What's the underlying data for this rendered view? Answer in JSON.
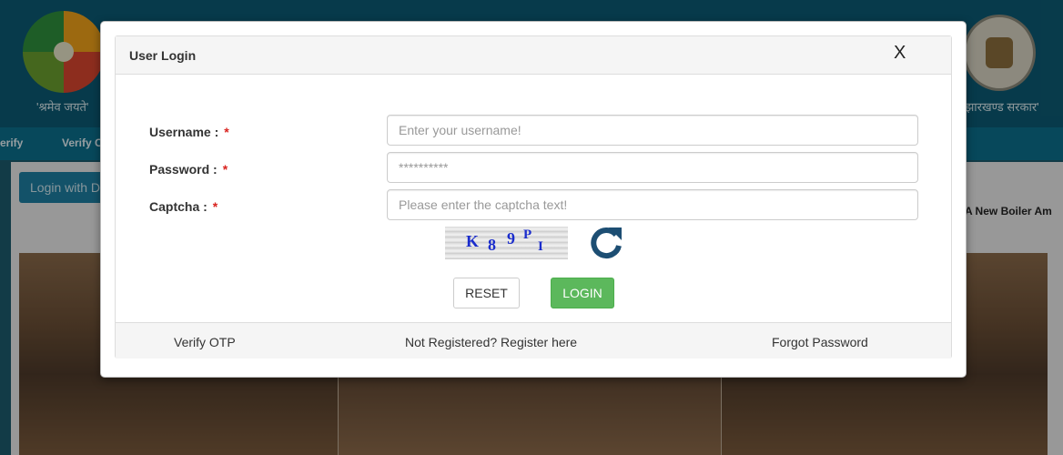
{
  "background": {
    "left_logo_caption": "'श्रमेव जयते'",
    "right_logo_caption": "'झारखण्ड सरकार'",
    "nav_items": [
      "erify",
      "Verify C"
    ],
    "side_button_label": "Login with D",
    "marquee_text": "A New Boiler Am"
  },
  "modal": {
    "title": "User Login",
    "close_label": "X",
    "fields": {
      "username": {
        "label": "Username :",
        "required_mark": "*",
        "placeholder": "Enter your username!",
        "value": ""
      },
      "password": {
        "label": "Password :",
        "required_mark": "*",
        "placeholder": "**********",
        "value": ""
      },
      "captcha": {
        "label": "Captcha :",
        "required_mark": "*",
        "placeholder": "Please enter the captcha text!",
        "value": ""
      }
    },
    "captcha_text": [
      "K",
      "8",
      "9",
      "P",
      "I"
    ],
    "buttons": {
      "reset": "RESET",
      "login": "LOGIN"
    },
    "footer": {
      "verify_otp": "Verify OTP",
      "register": "Not Registered? Register here",
      "forgot_password": "Forgot Password"
    }
  },
  "colors": {
    "login_button": "#5cb85c",
    "refresh_icon": "#1d4e73",
    "required_mark": "#d9231f",
    "captcha_text": "#1a2ccc"
  }
}
